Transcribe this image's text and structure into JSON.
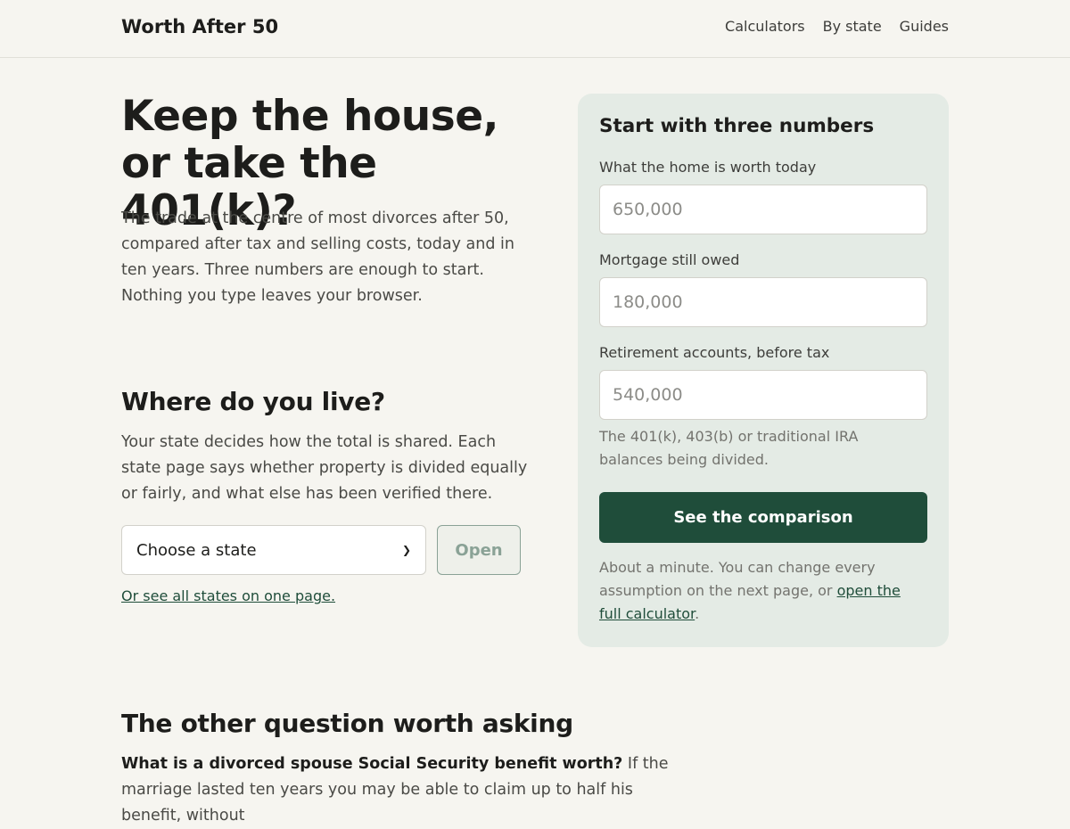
{
  "header": {
    "brand": "Worth After 50",
    "nav": [
      "Calculators",
      "By state",
      "Guides"
    ]
  },
  "hero": {
    "title": "Keep the house, or take the 401(k)?",
    "text": "The trade at the centre of most divorces after 50, compared after tax and selling costs, today and in ten years. Three numbers are enough to start. Nothing you type leaves your browser."
  },
  "state": {
    "title": "Where do you live?",
    "text": "Your state decides how the total is shared. Each state page says whether property is divided equally or fairly, and what else has been verified there.",
    "select_value": "Choose a state",
    "open_label": "Open",
    "all_link": "Or see all states on one page."
  },
  "card": {
    "title": "Start with three numbers",
    "home_label": "What the home is worth today",
    "home_placeholder": "650,000",
    "mortgage_label": "Mortgage still owed",
    "mortgage_placeholder": "180,000",
    "retirement_label": "Retirement accounts, before tax",
    "retirement_placeholder": "540,000",
    "retirement_help": "The 401(k), 403(b) or traditional IRA balances being divided.",
    "cta_label": "See the comparison",
    "note_before": "About a minute. You can change every assumption on the next page, or ",
    "note_link": "open the full calculator",
    "note_after": "."
  },
  "other": {
    "title": "The other question worth asking",
    "question": "What is a divorced spouse Social Security benefit worth?",
    "text": " If the marriage lasted ten years you may be able to claim up to half his benefit, without"
  }
}
